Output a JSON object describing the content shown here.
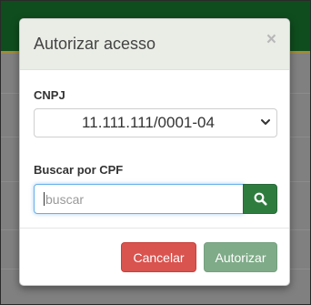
{
  "modal": {
    "title": "Autorizar acesso",
    "close_label": "×",
    "cnpj_label": "CNPJ",
    "cnpj_selected": "11.111.111/0001-04",
    "cpf_label": "Buscar por CPF",
    "search_placeholder": "buscar",
    "cancel_label": "Cancelar",
    "authorize_label": "Autorizar"
  },
  "colors": {
    "header_bar": "#0f4d1e",
    "cancel": "#d9534f",
    "authorize": "#7fab88",
    "search_button": "#2e7d3f"
  },
  "icons": {
    "select_arrow": "chevron-down-icon",
    "search_button": "search-icon"
  }
}
